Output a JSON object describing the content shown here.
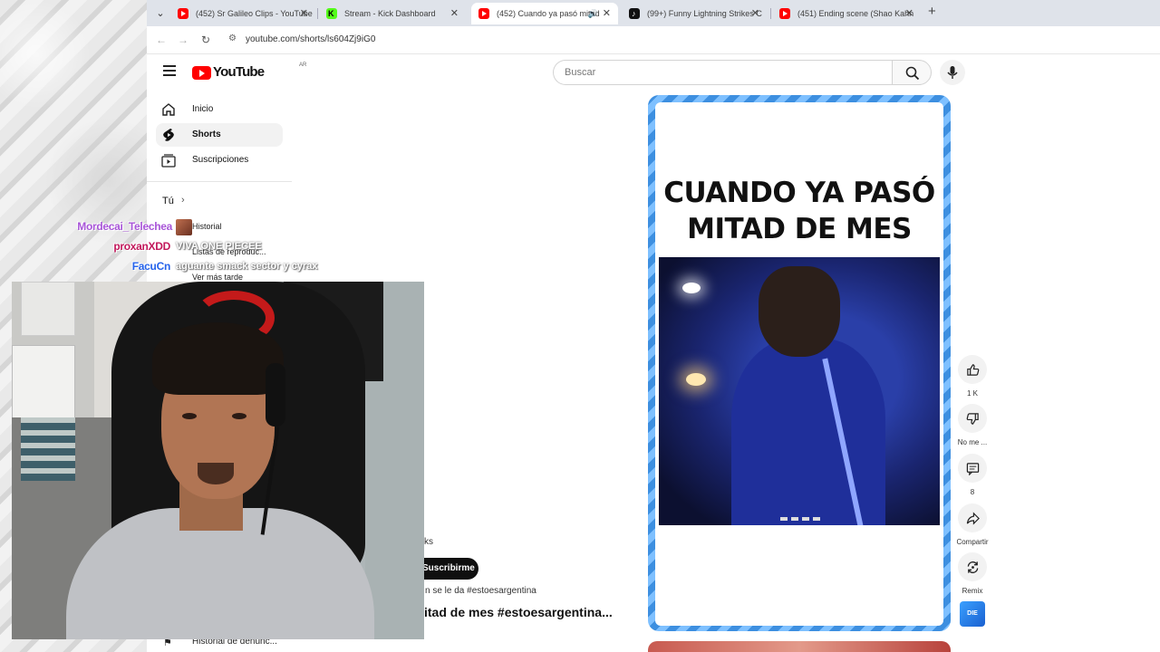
{
  "browser": {
    "tabs": [
      {
        "title": "(452) Sr Galileo Clips - YouTube",
        "favicon": "youtube-icon",
        "active": false
      },
      {
        "title": "Stream - Kick Dashboard",
        "favicon": "kick-icon",
        "active": false
      },
      {
        "title": "(452) Cuando ya pasó mitad",
        "favicon": "youtube-icon",
        "active": true
      },
      {
        "title": "(99+) Funny Lightning Strikes C",
        "favicon": "tiktok-icon",
        "active": false
      },
      {
        "title": "(451) Ending scene (Shao Kahn",
        "favicon": "youtube-icon",
        "active": false
      }
    ],
    "url": "youtube.com/shorts/ls604Zj9iG0"
  },
  "youtube": {
    "logo_text": "YouTube",
    "region": "AR",
    "search_placeholder": "Buscar",
    "sidebar": {
      "items": [
        {
          "label": "Inicio",
          "icon": "home-icon"
        },
        {
          "label": "Shorts",
          "icon": "shorts-icon",
          "selected": true
        },
        {
          "label": "Suscripciones",
          "icon": "subscriptions-icon"
        }
      ],
      "you_label": "Tú",
      "you_items": [
        "Historial",
        "Listas de reproduc...",
        "Ver más tarde"
      ],
      "bottom_item": "Historial de denunc..."
    },
    "short": {
      "caption": "CUANDO YA PASÓ MITAD DE MES",
      "channel_suffix": "ks",
      "subscribe_label": "Suscribirme",
      "description": "n se le da #estoesargentina",
      "title": "itad de mes #estoesargentina..."
    },
    "actions": [
      {
        "icon": "like-icon",
        "label": "1 K"
      },
      {
        "icon": "dislike-icon",
        "label": "No me ..."
      },
      {
        "icon": "comment-icon",
        "label": "8"
      },
      {
        "icon": "share-icon",
        "label": "Compartir"
      },
      {
        "icon": "remix-icon",
        "label": "Remix"
      }
    ],
    "remix_thumb_text": "DIE"
  },
  "overlay": {
    "chat": [
      {
        "user": "Mordecai_Telechea",
        "message": "",
        "color": "#a855d8"
      },
      {
        "user": "proxanXDD",
        "message": "VIVA ONE PIECEE",
        "color": "#c2185b"
      },
      {
        "user": "FacuCn",
        "message": "aguante smack sector y cyrax",
        "color": "#2563eb"
      }
    ]
  }
}
